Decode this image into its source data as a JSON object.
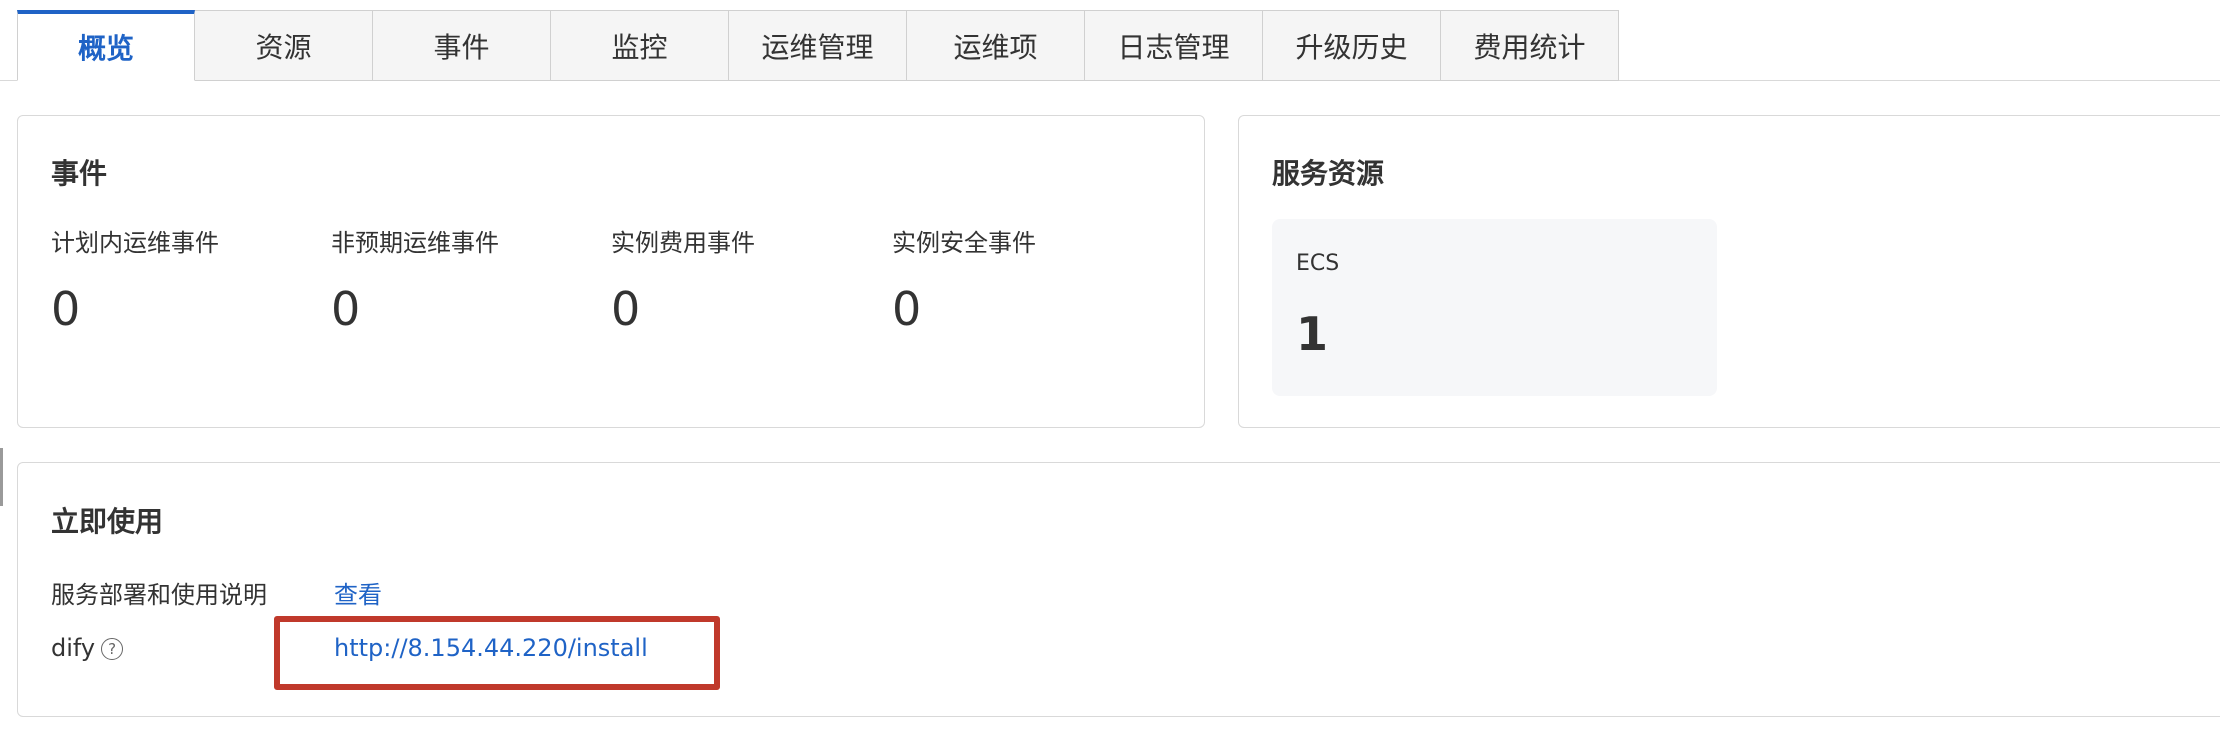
{
  "tabs": [
    {
      "label": "概览",
      "active": true
    },
    {
      "label": "资源"
    },
    {
      "label": "事件"
    },
    {
      "label": "监控"
    },
    {
      "label": "运维管理"
    },
    {
      "label": "运维项"
    },
    {
      "label": "日志管理"
    },
    {
      "label": "升级历史"
    },
    {
      "label": "费用统计"
    }
  ],
  "events_card": {
    "title": "事件",
    "items": [
      {
        "label": "计划内运维事件",
        "value": "0"
      },
      {
        "label": "非预期运维事件",
        "value": "0"
      },
      {
        "label": "实例费用事件",
        "value": "0"
      },
      {
        "label": "实例安全事件",
        "value": "0"
      }
    ]
  },
  "service_card": {
    "title": "服务资源",
    "resource": {
      "name": "ECS",
      "count": "1"
    }
  },
  "quick_start": {
    "title": "立即使用",
    "rows": [
      {
        "label": "服务部署和使用说明",
        "link": "查看"
      },
      {
        "label": "dify",
        "help_icon": "?",
        "link": "http://8.154.44.220/install"
      }
    ]
  },
  "colors": {
    "accent": "#1f63c6",
    "highlight": "#c0392b"
  },
  "icons": {
    "help": "question-circle-icon"
  }
}
